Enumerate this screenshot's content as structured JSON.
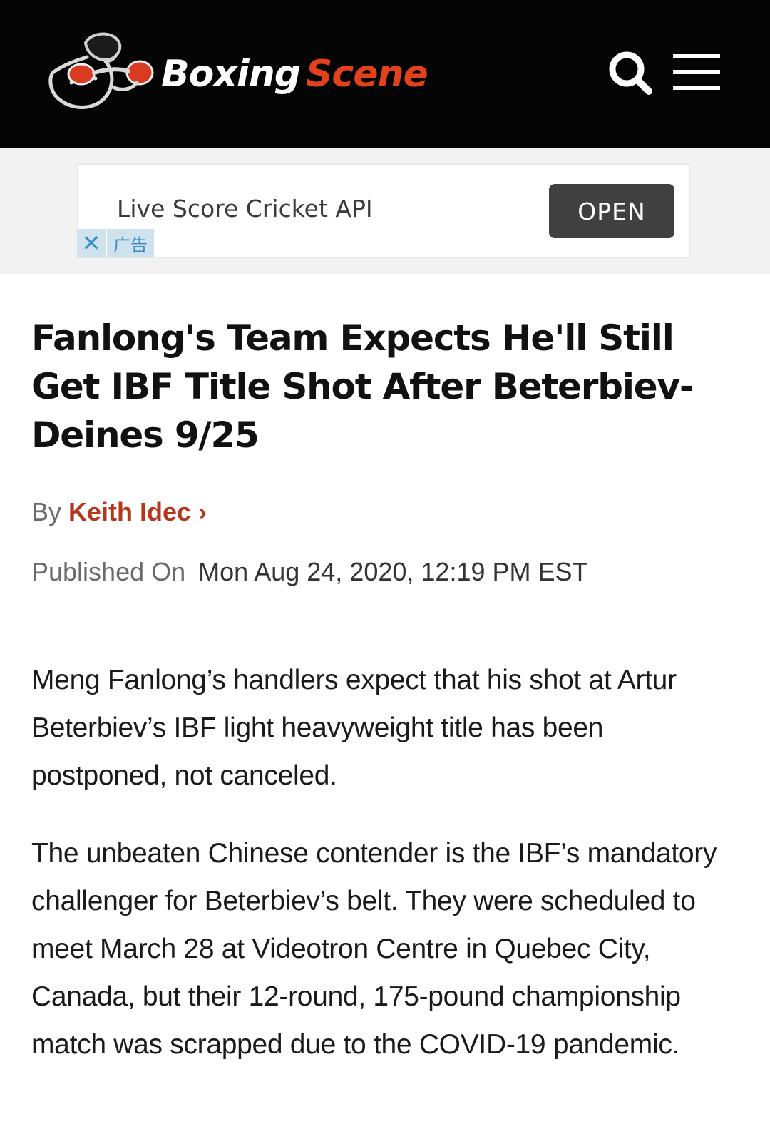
{
  "header": {
    "logo_word_1": "Boxing",
    "logo_word_2": "Scene",
    "brand_colors": {
      "background": "#050505",
      "accent": "#e2421b",
      "text": "#ffffff"
    },
    "icons": [
      "boxer-logo-icon",
      "search-icon",
      "hamburger-menu-icon"
    ]
  },
  "ad": {
    "title": "Live Score Cricket API",
    "cta": "OPEN",
    "close_glyph": "✕",
    "label": "广告"
  },
  "article": {
    "headline": "Fanlong's Team Expects He'll Still Get IBF Title Shot After Beterbiev-Deines 9/25",
    "by_label": "By",
    "author": "Keith Idec",
    "author_chevron": "›",
    "published_label": "Published On",
    "published_date": "Mon Aug 24, 2020, 12:19 PM EST",
    "paragraphs": [
      "Meng Fanlong’s handlers expect that his shot at Artur Beterbiev’s IBF light heavyweight title has been postponed, not canceled.",
      "The unbeaten Chinese contender is the IBF’s mandatory challenger for Beterbiev’s belt. They were scheduled to meet March 28 at Videotron Centre in Quebec City, Canada, but their 12-round, 175-pound championship match was scrapped due to the COVID-19 pandemic."
    ],
    "author_color": "#b5361a"
  }
}
